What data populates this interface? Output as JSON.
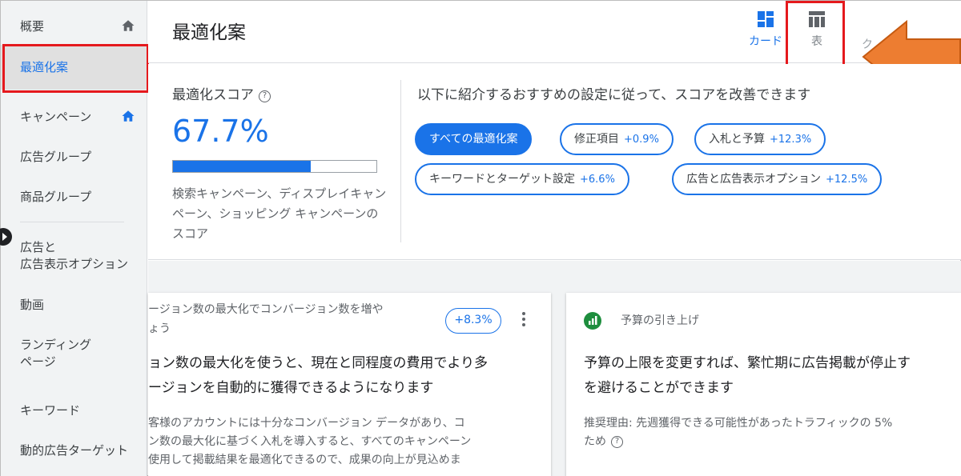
{
  "sidebar": {
    "items": [
      {
        "label": "概要",
        "home": true
      },
      {
        "label": "最適化案",
        "selected": true
      },
      {
        "label": "キャンペーン",
        "home": true
      },
      {
        "label": "広告グループ"
      },
      {
        "label": "商品グループ"
      },
      {
        "label": "広告と\n広告表示オプション"
      },
      {
        "label": "動画"
      },
      {
        "label": "ランディング\nページ"
      },
      {
        "label": "キーワード"
      },
      {
        "label": "動的広告ターゲット"
      }
    ]
  },
  "header": {
    "title": "最適化案",
    "views": {
      "card_label": "カード",
      "table_label": "表",
      "third_label": "ク"
    }
  },
  "score": {
    "title": "最適化スコア",
    "value": "67.7%",
    "progress_fraction": 0.677,
    "description": "検索キャンペーン、ディスプレイキャンペーン、ショッピング キャンペーンのスコア"
  },
  "recommendations": {
    "heading": "以下に紹介するおすすめの設定に従って、スコアを改善できます",
    "chips": [
      {
        "label": "すべての最適化案",
        "delta": "",
        "active": true
      },
      {
        "label": "修正項目",
        "delta": "+0.9%"
      },
      {
        "label": "入札と予算",
        "delta": "+12.3%"
      },
      {
        "label": "キーワードとターゲット設定",
        "delta": "+6.6%"
      },
      {
        "label": "広告と広告表示オプション",
        "delta": "+12.5%"
      }
    ]
  },
  "cards": [
    {
      "subtitle_line1": "ージョン数の最大化でコンバージョン数を増や",
      "subtitle_line2": "ょう",
      "badge": "+8.3%",
      "main_line1": "ョン数の最大化を使うと、現在と同程度の費用でより多",
      "main_line2": "ージョンを自動的に獲得できるようになります",
      "body_line1": "客様のアカウントには十分なコンバージョン データがあり、コ",
      "body_line2": "ン数の最大化に基づく入札を導入すると、すべてのキャンペーン",
      "body_line3": "使用して掲載結果を最適化できるので、成果の向上が見込めま"
    },
    {
      "subtitle": "予算の引き上げ",
      "main_line1": "予算の上限を変更すれば、繁忙期に広告掲載が停止す",
      "main_line2": "を避けることができます",
      "body_line1": "推奨理由: 先週獲得できる可能性があったトラフィックの 5%",
      "body_line2": "ため"
    }
  ],
  "colors": {
    "accent": "#1a73e8",
    "highlight_box": "#e5191d",
    "arrow": "#ed7d31",
    "sidebar_bg": "#f1f3f4"
  }
}
